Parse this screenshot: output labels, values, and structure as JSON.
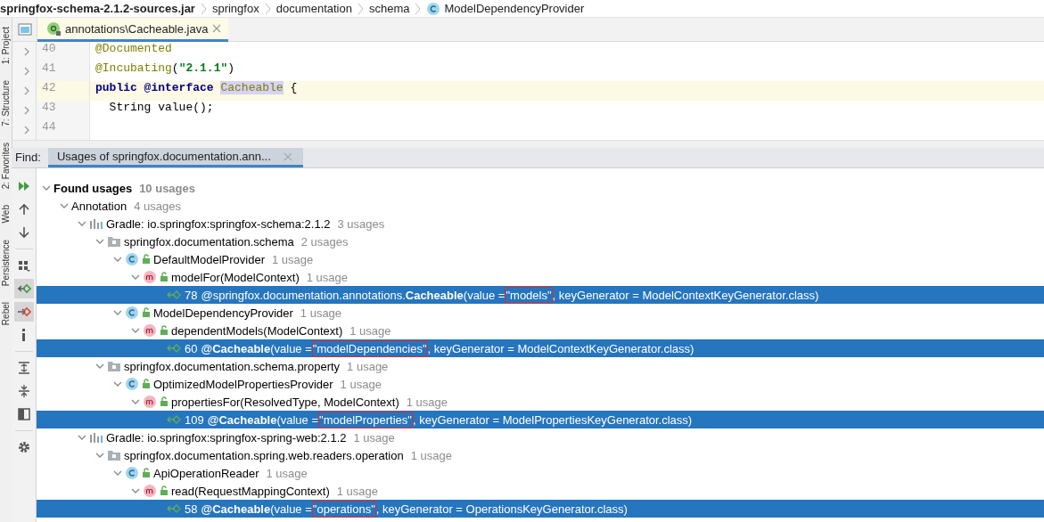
{
  "breadcrumb": [
    {
      "kind": "jar",
      "label": "springfox-schema-2.1.2-sources.jar"
    },
    {
      "kind": "folder",
      "label": "springfox"
    },
    {
      "kind": "folder",
      "label": "documentation"
    },
    {
      "kind": "folder",
      "label": "schema"
    },
    {
      "kind": "class",
      "label": "ModelDependencyProvider"
    }
  ],
  "side_strip": [
    "1: Project",
    "7: Structure",
    "2: Favorites",
    "Web",
    "Persistence",
    "Rebel"
  ],
  "editor": {
    "tab": {
      "title": "annotations\\Cacheable.java",
      "selected": true
    },
    "lines": [
      {
        "number": "40",
        "current": false,
        "tokens": [
          {
            "kind": "annotation",
            "text": "@Documented"
          }
        ]
      },
      {
        "number": "41",
        "current": false,
        "tokens": [
          {
            "kind": "annotation",
            "text": "@Incubating"
          },
          {
            "kind": "plain",
            "text": "("
          },
          {
            "kind": "string",
            "text": "\"2.1.1\""
          },
          {
            "kind": "plain",
            "text": ")"
          }
        ]
      },
      {
        "number": "42",
        "current": true,
        "tokens": [
          {
            "kind": "keyword",
            "text": "public @interface "
          },
          {
            "kind": "symbol",
            "text": "Cacheable"
          },
          {
            "kind": "plain",
            "text": " {"
          }
        ]
      },
      {
        "number": "43",
        "current": false,
        "tokens": [
          {
            "kind": "plain",
            "text": "  String value();"
          }
        ]
      },
      {
        "number": "44",
        "current": false
      }
    ]
  },
  "find_panel": {
    "label": "Find:",
    "tab": {
      "title": "Usages of springfox.documentation.ann...",
      "selected": true
    },
    "toolbar": [
      {
        "kind": "rerun",
        "on": false
      },
      {
        "kind": "up",
        "on": false
      },
      {
        "kind": "down",
        "on": false
      },
      {
        "kind": "group",
        "on": false
      },
      {
        "kind": "navigate",
        "on": true
      },
      {
        "kind": "navigate-red",
        "on": true
      },
      {
        "kind": "info",
        "on": false
      },
      {
        "kind": "expand",
        "on": false
      },
      {
        "kind": "collapse",
        "on": false
      },
      {
        "kind": "preview",
        "on": false
      },
      {
        "kind": "settings",
        "on": false
      }
    ],
    "tree": [
      {
        "kind": "root",
        "label": "Found usages",
        "count": "10 usages",
        "expanded": true,
        "children": [
          {
            "kind": "group",
            "label": "Annotation",
            "count": "4 usages",
            "expanded": true,
            "children": [
              {
                "kind": "module",
                "label": "Gradle: io.springfox:springfox-schema:2.1.2",
                "count": "3 usages",
                "expanded": true,
                "children": [
                  {
                    "kind": "package",
                    "label": "springfox.documentation.schema",
                    "count": "2 usages",
                    "expanded": true,
                    "children": [
                      {
                        "kind": "class",
                        "label": "DefaultModelProvider",
                        "count": "1 usage",
                        "expanded": true,
                        "children": [
                          {
                            "kind": "method",
                            "label": "modelFor(ModelContext)",
                            "count": "1 usage",
                            "expanded": true,
                            "children": [
                              {
                                "kind": "usage",
                                "selected": true,
                                "line": "78",
                                "code": "@springfox.documentation.annotations.**Cacheable**(value = ",
                                "value": "\"models\"",
                                "rest": ", keyGenerator = ModelContextKeyGenerator.class)"
                              }
                            ]
                          }
                        ]
                      },
                      {
                        "kind": "class",
                        "label": "ModelDependencyProvider",
                        "count": "1 usage",
                        "expanded": true,
                        "children": [
                          {
                            "kind": "method",
                            "label": "dependentModels(ModelContext)",
                            "count": "1 usage",
                            "expanded": true,
                            "children": [
                              {
                                "kind": "usage",
                                "selected": true,
                                "line": "60",
                                "code": "**@Cacheable**(value = ",
                                "value": "\"modelDependencies\"",
                                "rest": ", keyGenerator = ModelContextKeyGenerator.class)"
                              }
                            ]
                          }
                        ]
                      }
                    ]
                  },
                  {
                    "kind": "package",
                    "label": "springfox.documentation.schema.property",
                    "count": "1 usage",
                    "expanded": true,
                    "children": [
                      {
                        "kind": "class",
                        "label": "OptimizedModelPropertiesProvider",
                        "count": "1 usage",
                        "expanded": true,
                        "children": [
                          {
                            "kind": "method",
                            "label": "propertiesFor(ResolvedType, ModelContext)",
                            "count": "1 usage",
                            "expanded": true,
                            "children": [
                              {
                                "kind": "usage",
                                "selected": true,
                                "line": "109",
                                "code": "**@Cacheable**(value = ",
                                "value": "\"modelProperties\"",
                                "rest": ", keyGenerator = ModelPropertiesKeyGenerator.class)"
                              }
                            ]
                          }
                        ]
                      }
                    ]
                  }
                ]
              },
              {
                "kind": "module",
                "label": "Gradle: io.springfox:springfox-spring-web:2.1.2",
                "count": "1 usage",
                "expanded": true,
                "children": [
                  {
                    "kind": "package",
                    "label": "springfox.documentation.spring.web.readers.operation",
                    "count": "1 usage",
                    "expanded": true,
                    "children": [
                      {
                        "kind": "class",
                        "label": "ApiOperationReader",
                        "count": "1 usage",
                        "expanded": true,
                        "children": [
                          {
                            "kind": "method",
                            "label": "read(RequestMappingContext)",
                            "count": "1 usage",
                            "expanded": true,
                            "children": [
                              {
                                "kind": "usage",
                                "selected": true,
                                "line": "58",
                                "code": "**@Cacheable**(value = ",
                                "value": "\"operations\"",
                                "rest": ", keyGenerator = OperationsKeyGenerator.class)"
                              }
                            ]
                          }
                        ]
                      }
                    ]
                  }
                ]
              }
            ]
          }
        ]
      }
    ]
  }
}
